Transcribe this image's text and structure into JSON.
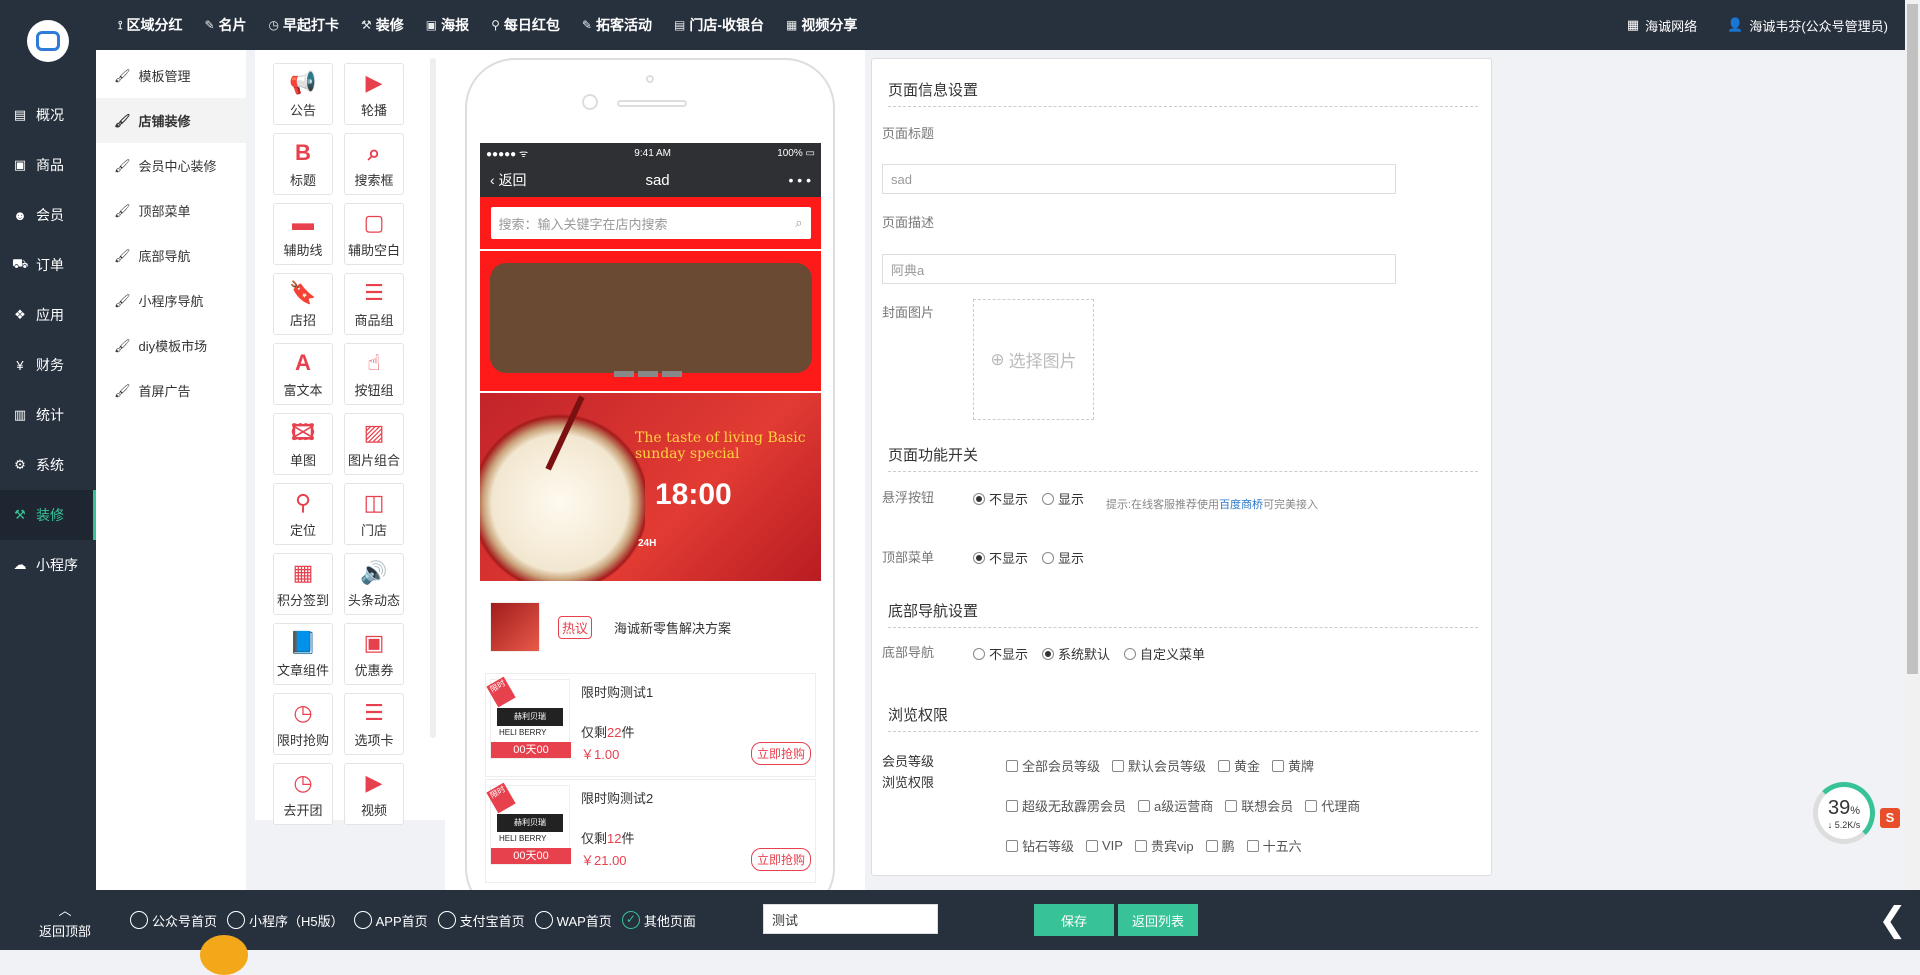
{
  "top_nav": {
    "items": [
      {
        "icon": "partner-icon",
        "glyph": "⟟",
        "label": "区域分红"
      },
      {
        "icon": "card-icon",
        "glyph": "✎",
        "label": "名片"
      },
      {
        "icon": "clock-icon",
        "glyph": "◷",
        "label": "早起打卡"
      },
      {
        "icon": "hammer-icon",
        "glyph": "⚒",
        "label": "装修"
      },
      {
        "icon": "image-icon",
        "glyph": "▣",
        "label": "海报"
      },
      {
        "icon": "link-icon",
        "glyph": "⚲",
        "label": "每日红包"
      },
      {
        "icon": "handshake-icon",
        "glyph": "✎",
        "label": "拓客活动"
      },
      {
        "icon": "cashier-icon",
        "glyph": "▤",
        "label": "门店-收银台"
      },
      {
        "icon": "video-icon",
        "glyph": "▦",
        "label": "视频分享"
      }
    ],
    "right": {
      "network_label": "海诚网络",
      "user_label": "海诚韦芬(公众号管理员)"
    }
  },
  "sidebar": {
    "items": [
      {
        "name": "overview",
        "glyph": "▤",
        "label": "概况"
      },
      {
        "name": "goods",
        "glyph": "▣",
        "label": "商品"
      },
      {
        "name": "members",
        "glyph": "☻",
        "label": "会员"
      },
      {
        "name": "orders",
        "glyph": "⛟",
        "label": "订单"
      },
      {
        "name": "apps",
        "glyph": "❖",
        "label": "应用"
      },
      {
        "name": "finance",
        "glyph": "¥",
        "label": "财务"
      },
      {
        "name": "stats",
        "glyph": "▥",
        "label": "统计"
      },
      {
        "name": "system",
        "glyph": "⚙",
        "label": "系统"
      },
      {
        "name": "decoration",
        "glyph": "⚒",
        "label": "装修"
      },
      {
        "name": "miniapp",
        "glyph": "☁",
        "label": "小程序"
      }
    ],
    "active_index": 8
  },
  "sub_nav": {
    "items": [
      {
        "label": "模板管理"
      },
      {
        "label": "店铺装修"
      },
      {
        "label": "会员中心装修"
      },
      {
        "label": "顶部菜单"
      },
      {
        "label": "底部导航"
      },
      {
        "label": "小程序导航"
      },
      {
        "label": "diy模板市场"
      },
      {
        "label": "首屏广告"
      }
    ],
    "active_index": 1
  },
  "components": [
    {
      "icon": "megaphone-icon",
      "glyph": "📢",
      "label": "公告"
    },
    {
      "icon": "carousel-icon",
      "glyph": "▶",
      "label": "轮播"
    },
    {
      "icon": "bold-icon",
      "glyph": "B",
      "label": "标题"
    },
    {
      "icon": "search-icon",
      "glyph": "⌕",
      "label": "搜索框"
    },
    {
      "icon": "divider-icon",
      "glyph": "▬",
      "label": "辅助线"
    },
    {
      "icon": "blank-icon",
      "glyph": "▢",
      "label": "辅助空白"
    },
    {
      "icon": "bookmark-icon",
      "glyph": "🔖",
      "label": "店招"
    },
    {
      "icon": "product-group-icon",
      "glyph": "☰",
      "label": "商品组"
    },
    {
      "icon": "rich-text-icon",
      "glyph": "A",
      "label": "富文本"
    },
    {
      "icon": "hand-pointer-icon",
      "glyph": "☝",
      "label": "按钮组"
    },
    {
      "icon": "single-image-icon",
      "glyph": "🖾",
      "label": "单图"
    },
    {
      "icon": "image-group-icon",
      "glyph": "▨",
      "label": "图片组合"
    },
    {
      "icon": "location-icon",
      "glyph": "⚲",
      "label": "定位"
    },
    {
      "icon": "store-icon",
      "glyph": "◫",
      "label": "门店"
    },
    {
      "icon": "calendar-icon",
      "glyph": "▦",
      "label": "积分签到"
    },
    {
      "icon": "volume-icon",
      "glyph": "🔊",
      "label": "头条动态"
    },
    {
      "icon": "article-icon",
      "glyph": "📘",
      "label": "文章组件"
    },
    {
      "icon": "coupon-icon",
      "glyph": "▣",
      "label": "优惠券"
    },
    {
      "icon": "flash-sale-clock-icon",
      "glyph": "◷",
      "label": "限时抢购"
    },
    {
      "icon": "tabs-icon",
      "glyph": "☰",
      "label": "选项卡"
    },
    {
      "icon": "group-buy-clock-icon",
      "glyph": "◷",
      "label": "去开团"
    },
    {
      "icon": "video-icon",
      "glyph": "▶",
      "label": "视频"
    }
  ],
  "phone": {
    "status_left": "●●●●● ᯤ",
    "status_time": "9:41 AM",
    "status_battery": "100%",
    "back_label": "返回",
    "title": "sad",
    "more": "• • •",
    "search_placeholder": "搜索：输入关键字在店内搜索",
    "promo": {
      "line1": "The taste of living Basic",
      "line2": "sunday special",
      "time": "18:00",
      "brand": "24H"
    },
    "news": {
      "tag": "热议",
      "text": "海诚新零售解决方案"
    },
    "flash_items": [
      {
        "name": "限时购测试1",
        "remain_prefix": "仅剩",
        "remain_count": "22",
        "remain_suffix": "件",
        "price": "￥1.00",
        "countdown": "00天00",
        "buy_label": "立即抢购",
        "logo_cn": "赫利贝瑞",
        "logo_en": "HELI BERRY",
        "corner": "限时"
      },
      {
        "name": "限时购测试2",
        "remain_prefix": "仅剩",
        "remain_count": "12",
        "remain_suffix": "件",
        "price": "￥21.00",
        "countdown": "00天00",
        "buy_label": "立即抢购",
        "logo_cn": "赫利贝瑞",
        "logo_en": "HELI BERRY",
        "corner": "限时"
      }
    ]
  },
  "settings": {
    "page_info_title": "页面信息设置",
    "page_title_label": "页面标题",
    "page_title_value": "sad",
    "page_desc_label": "页面描述",
    "page_desc_value": "阿典a",
    "cover_label": "封面图片",
    "cover_pick_label": "选择图片",
    "func_title": "页面功能开关",
    "float_btn_label": "悬浮按钮",
    "hide_label": "不显示",
    "show_label": "显示",
    "hint_prefix": "提示:在线客服推荐使用",
    "hint_link": "百度商桥",
    "hint_suffix": "可完美接入",
    "top_menu_label": "顶部菜单",
    "bottom_nav_title": "底部导航设置",
    "bottom_nav_label": "底部导航",
    "bottom_nav_options": [
      "不显示",
      "系统默认",
      "自定义菜单"
    ],
    "bottom_nav_selected": 1,
    "browse_title": "浏览权限",
    "member_label_1": "会员等级",
    "member_label_2": "浏览权限",
    "member_levels": [
      [
        "全部会员等级",
        "默认会员等级",
        "黄金",
        "黄牌"
      ],
      [
        "超级无敌霹雳会员",
        "a级运营商",
        "联想会员",
        "代理商"
      ],
      [
        "钻石等级",
        "VIP",
        "贵宾vip",
        "鹏",
        "十五六"
      ]
    ]
  },
  "widget": {
    "percent": "39",
    "percent_unit": "%",
    "rate": "↓ 5.2K/s",
    "badge": "S"
  },
  "bottom_bar": {
    "back_top_arrow": "︿",
    "back_top_label": "返回顶部",
    "tabs": [
      "公众号首页",
      "小程序（H5版）",
      "APP首页",
      "支付宝首页",
      "WAP首页",
      "其他页面"
    ],
    "selected_tab": 5,
    "input_value": "测试",
    "save_label": "保存",
    "back_list_label": "返回列表",
    "collapse_glyph": "❮"
  },
  "colors": {
    "accent": "#37c397",
    "nav_bg": "#27313e",
    "brand_red": "#e8414e"
  }
}
